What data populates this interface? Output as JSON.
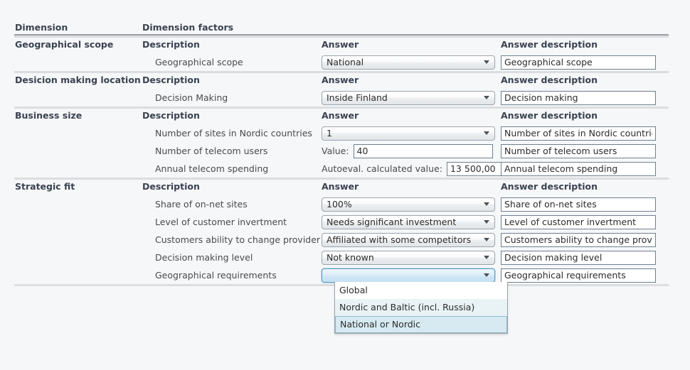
{
  "table": {
    "headers": {
      "dimension": "Dimension",
      "dimension_factors": "Dimension factors",
      "description": "Description",
      "answer": "Answer",
      "answer_description": "Answer description"
    },
    "groups": [
      {
        "dimension": "Geographical scope",
        "col_description": "Description",
        "col_answer": "Answer",
        "col_answer_description": "Answer description",
        "rows": [
          {
            "label": "Geographical scope",
            "control": "select",
            "value": "National",
            "answer_description": "Geographical scope"
          }
        ]
      },
      {
        "dimension": "Desicion making location",
        "col_description": "Description",
        "col_answer": "Answer",
        "col_answer_description": "Answer description",
        "rows": [
          {
            "label": "Decision Making",
            "control": "select",
            "value": "Inside Finland",
            "answer_description": "Decision making"
          }
        ]
      },
      {
        "dimension": "Business size",
        "col_description": "Description",
        "col_answer": "Answer",
        "col_answer_description": "Answer description",
        "rows": [
          {
            "label": "Number of sites in Nordic countries",
            "control": "select",
            "value": "1",
            "answer_description": "Number of sites in Nordic countries"
          },
          {
            "label": "Number of telecom users",
            "control": "value-input",
            "inline_label": "Value:",
            "value": "40",
            "answer_description": "Number of telecom users"
          },
          {
            "label": "Annual telecom spending",
            "control": "calc-input",
            "inline_label": "Autoeval. calculated value:",
            "value": "13 500,00",
            "answer_description": "Annual telecom spending"
          }
        ]
      },
      {
        "dimension": "Strategic fit",
        "col_description": "Description",
        "col_answer": "Answer",
        "col_answer_description": "Answer description",
        "rows": [
          {
            "label": "Share of on-net sites",
            "control": "select",
            "value": "100%",
            "answer_description": "Share of on-net sites"
          },
          {
            "label": "Level of customer invertment",
            "control": "select",
            "value": "Needs significant investment",
            "answer_description": "Level of customer invertment"
          },
          {
            "label": "Customers ability to change provider",
            "control": "select",
            "value": "Affiliated with some competitors",
            "answer_description": "Customers ability to change provider"
          },
          {
            "label": "Decision making level",
            "control": "select",
            "value": "Not known",
            "answer_description": "Decision making level"
          },
          {
            "label": "Geographical requirements",
            "control": "select-open",
            "value": "",
            "answer_description": "Geographical requirements"
          }
        ]
      }
    ]
  },
  "dropdown": {
    "open": true,
    "options": [
      {
        "label": "Global",
        "state": "normal"
      },
      {
        "label": "Nordic and Baltic (incl. Russia)",
        "state": "alt"
      },
      {
        "label": "National or Nordic",
        "state": "selected"
      }
    ]
  },
  "colors": {
    "page_background": "#f5f7f9",
    "header_rule": "#9aa0a6",
    "group_rule": "#dcdddf",
    "heading_text": "#3b4250",
    "body_text": "#4a4a4a",
    "focus_border": "#5d9ec4",
    "option_alt": "#e9f3f5",
    "option_selected": "#d7eaf1"
  }
}
